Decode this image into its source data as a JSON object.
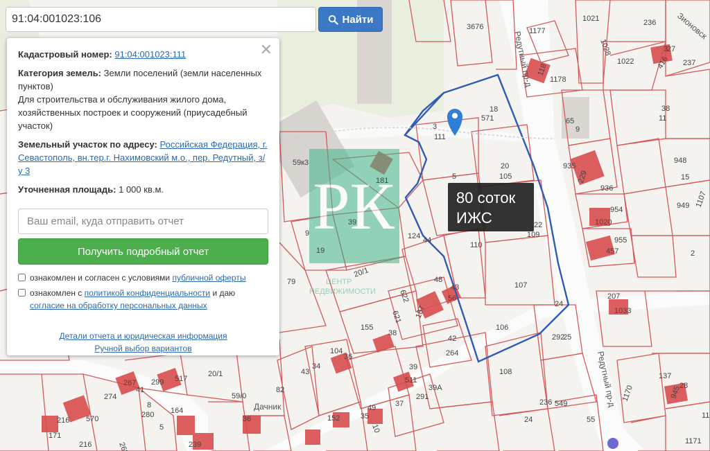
{
  "search": {
    "value": "91:04:001023:106",
    "button_label": "Найти"
  },
  "panel": {
    "cad_label": "Кадастровый номер:",
    "cad_value": "91:04:001023:111",
    "cat_label": "Категория земель:",
    "cat_value": "Земли поселений (земли населенных пунктов)",
    "use_text": "Для строительства и обслуживания жилого дома, хозяйственных построек и сооружений (приусадебный участок)",
    "addr_label": "Земельный участок по адресу:",
    "addr_value": "Российская Федерация, г. Севастополь, вн.тер.г. Нахимовский м.о., пер. Редутный, з/у 3",
    "area_label": "Уточненная площадь:",
    "area_value": "1 000 кв.м.",
    "email_placeholder": "Ваш email, куда отправить отчет",
    "get_button": "Получить подробный отчет",
    "chk1_text": "ознакомлен и согласен с условиями",
    "chk1_link": "публичной оферты",
    "chk2_text": "ознакомлен с",
    "chk2_link": "политикой конфиденциальности",
    "chk2_text2": "и даю",
    "chk2_link2": "согласие на обработку персональных данных",
    "details_link": "Детали отчета и юридическая информация",
    "manual_link": "Ручной выбор вариантов"
  },
  "tooltip": {
    "line1": "80 соток",
    "line2": "ИЖС"
  },
  "map": {
    "parcel_labels": [
      "3676",
      "1177",
      "1021",
      "1028",
      "236",
      "3",
      "27",
      "237",
      "1022",
      "1178",
      "118",
      "416",
      "38",
      "11",
      "18",
      "571",
      "3",
      "111",
      "65",
      "9",
      "20",
      "105",
      "948",
      "935",
      "229",
      "15",
      "936",
      "949",
      "1107",
      "954",
      "1020",
      "22",
      "109",
      "955",
      "457",
      "2",
      "124",
      "44",
      "110",
      "107",
      "207",
      "1033",
      "24",
      "106",
      "292",
      "25",
      "181",
      "59к3",
      "39",
      "19",
      "5",
      "79",
      "20/1",
      "622",
      "48",
      "43",
      "621",
      "187",
      "56",
      "155",
      "38",
      "104",
      "36",
      "42",
      "264",
      "34",
      "43",
      "108",
      "137",
      "28",
      "945",
      "1170",
      "20/1",
      "299",
      "517",
      "267",
      "274",
      "41",
      "8",
      "280",
      "216",
      "570",
      "59/0",
      "82",
      "39",
      "511",
      "39А",
      "291",
      "49",
      "37",
      "35",
      "152",
      "55",
      "10",
      "24",
      "549",
      "236",
      "1171",
      "164",
      "36",
      "239",
      "171",
      "216",
      "265",
      "5",
      "1171",
      "9"
    ],
    "street1": "Редутный пр-д",
    "street2": "Редутный пр-д",
    "street3": "Зионовск",
    "place": "Дачник",
    "watermark_line1": "ЦЕНТР",
    "watermark_line2": "НЕДВИЖИМОСТИ",
    "watermark_mark": "РК",
    "colors": {
      "parcel": "#d35a5a",
      "highlight": "#2f5bb5",
      "building": "#d94c4c",
      "road": "#fbfbfb",
      "watermark": "#3fb48a",
      "pin": "#2f7fd6"
    }
  }
}
